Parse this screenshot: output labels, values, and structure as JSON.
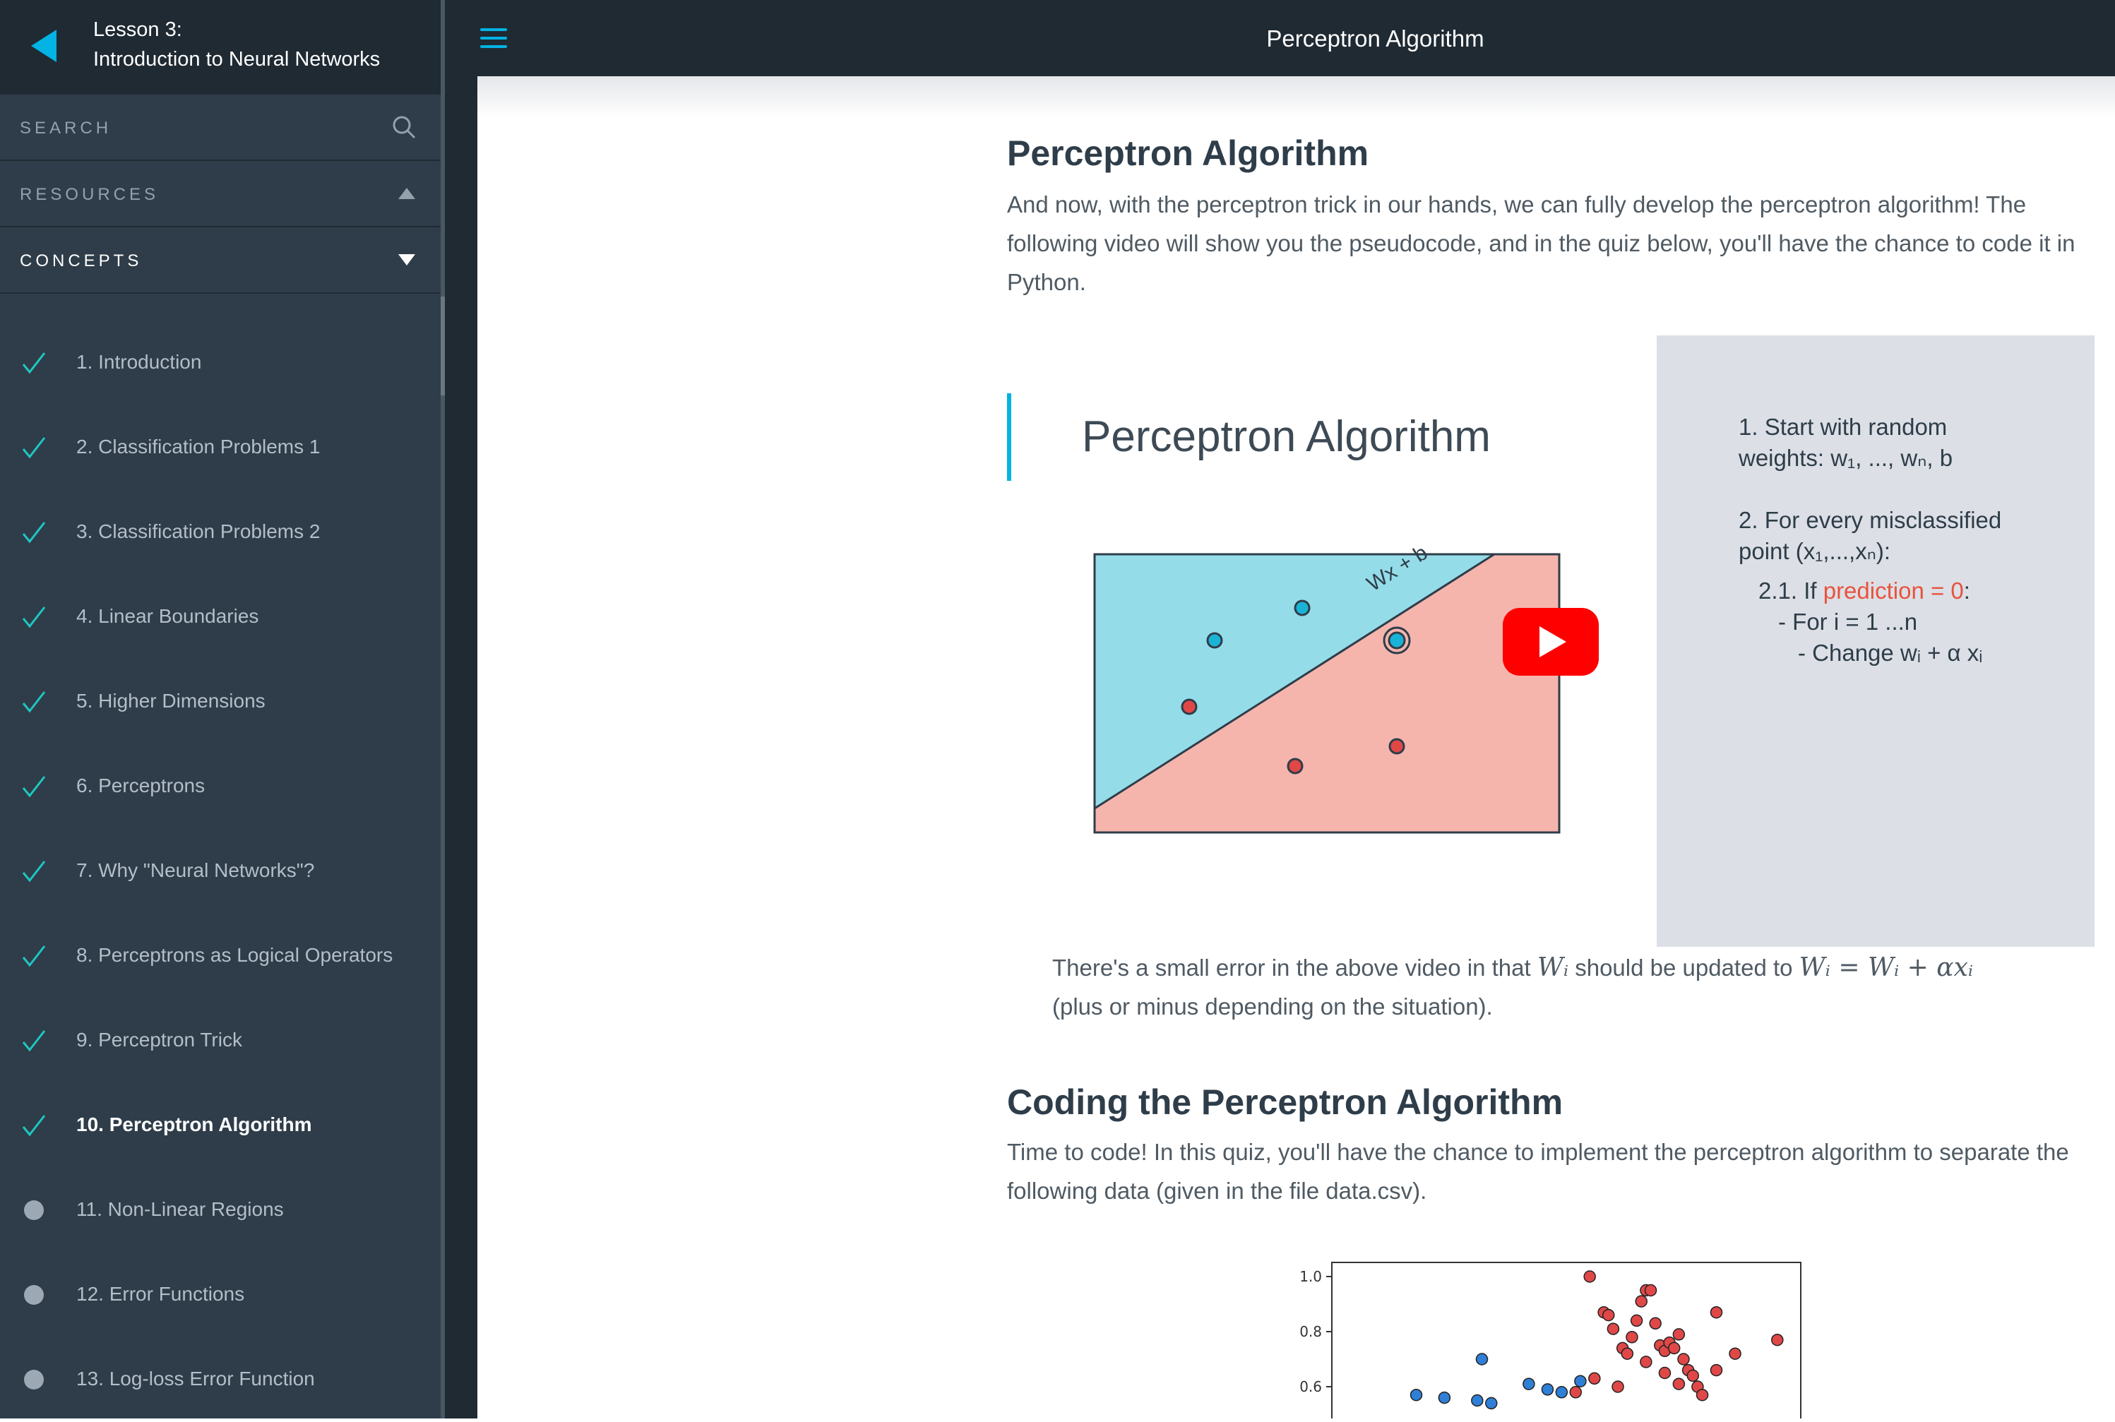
{
  "sidebar": {
    "lesson_number": "Lesson 3:",
    "lesson_title": "Introduction to Neural Networks",
    "search_label": "SEARCH",
    "resources_label": "RESOURCES",
    "concepts_label": "CONCEPTS",
    "concepts": [
      {
        "label": "1. Introduction",
        "status": "complete"
      },
      {
        "label": "2. Classification Problems 1",
        "status": "complete"
      },
      {
        "label": "3. Classification Problems 2",
        "status": "complete"
      },
      {
        "label": "4. Linear Boundaries",
        "status": "complete"
      },
      {
        "label": "5. Higher Dimensions",
        "status": "complete"
      },
      {
        "label": "6. Perceptrons",
        "status": "complete"
      },
      {
        "label": "7. Why \"Neural Networks\"?",
        "status": "complete"
      },
      {
        "label": "8. Perceptrons as Logical Operators",
        "status": "complete"
      },
      {
        "label": "9. Perceptron Trick",
        "status": "complete"
      },
      {
        "label": "10. Perceptron Algorithm",
        "status": "current"
      },
      {
        "label": "11. Non-Linear Regions",
        "status": "incomplete"
      },
      {
        "label": "12. Error Functions",
        "status": "incomplete"
      },
      {
        "label": "13. Log-loss Error Function",
        "status": "incomplete"
      }
    ]
  },
  "topbar": {
    "title": "Perceptron Algorithm"
  },
  "content": {
    "heading": "Perceptron Algorithm",
    "intro": "And now, with the perceptron trick in our hands, we can fully develop the perceptron algorithm! The following video will show you the pseudocode, and in the quiz below, you'll have the chance to code it in Python.",
    "video": {
      "title": "Perceptron Algorithm",
      "line_label": "Wx + b",
      "step1a": "1. Start with random",
      "step1b": "weights: w₁, ..., wₙ, b",
      "step2a": "2. For every misclassified",
      "step2b": "point (x₁,...,xₙ):",
      "step21_prefix": "2.1. If ",
      "step21_red": "prediction = 0",
      "step21_suffix": ":",
      "step22": "- For i = 1 ...n",
      "step23": "- Change wᵢ + α xᵢ"
    },
    "note_pre": "There's a small error in the above video in that ",
    "note_w": "Wᵢ",
    "note_mid": " should be updated to ",
    "note_eq": "Wᵢ = Wᵢ + αxᵢ",
    "note_post": "(plus or minus depending on the situation).",
    "heading2": "Coding the Perceptron Algorithm",
    "para2": "Time to code! In this quiz, you'll have the chance to implement the perceptron algorithm to separate the following data (given in the file data.csv).",
    "colors": {
      "accent": "#02b3e4",
      "check": "#1fc7c1",
      "blue_region": "#95dce9",
      "red_region": "#f5b5ad",
      "red_point": "#e04848",
      "blue_point": "#2f7fd6"
    }
  },
  "chart_data": {
    "type": "scatter",
    "title": "",
    "xlabel": "",
    "ylabel": "",
    "yticks": [
      "1.0",
      "0.8",
      "0.6"
    ],
    "ylim": [
      0.55,
      1.05
    ],
    "xlim": [
      0,
      1
    ],
    "series": [
      {
        "color": "red",
        "x": [
          0.55,
          0.58,
          0.59,
          0.6,
          0.62,
          0.63,
          0.64,
          0.65,
          0.66,
          0.67,
          0.68,
          0.69,
          0.7,
          0.71,
          0.72,
          0.73,
          0.74,
          0.75,
          0.76,
          0.77,
          0.78,
          0.82,
          0.82,
          0.86,
          0.95,
          0.52,
          0.56,
          0.61,
          0.67,
          0.71,
          0.74,
          0.79
        ],
        "y": [
          1.0,
          0.87,
          0.86,
          0.81,
          0.74,
          0.72,
          0.78,
          0.84,
          0.91,
          0.95,
          0.95,
          0.83,
          0.75,
          0.73,
          0.76,
          0.74,
          0.79,
          0.7,
          0.66,
          0.64,
          0.6,
          0.66,
          0.87,
          0.72,
          0.77,
          0.58,
          0.63,
          0.6,
          0.69,
          0.65,
          0.61,
          0.57
        ]
      },
      {
        "color": "blue",
        "x": [
          0.18,
          0.24,
          0.32,
          0.31,
          0.42,
          0.49,
          0.53,
          0.46,
          0.34
        ],
        "y": [
          0.57,
          0.56,
          0.7,
          0.55,
          0.61,
          0.58,
          0.62,
          0.59,
          0.54
        ]
      }
    ]
  }
}
